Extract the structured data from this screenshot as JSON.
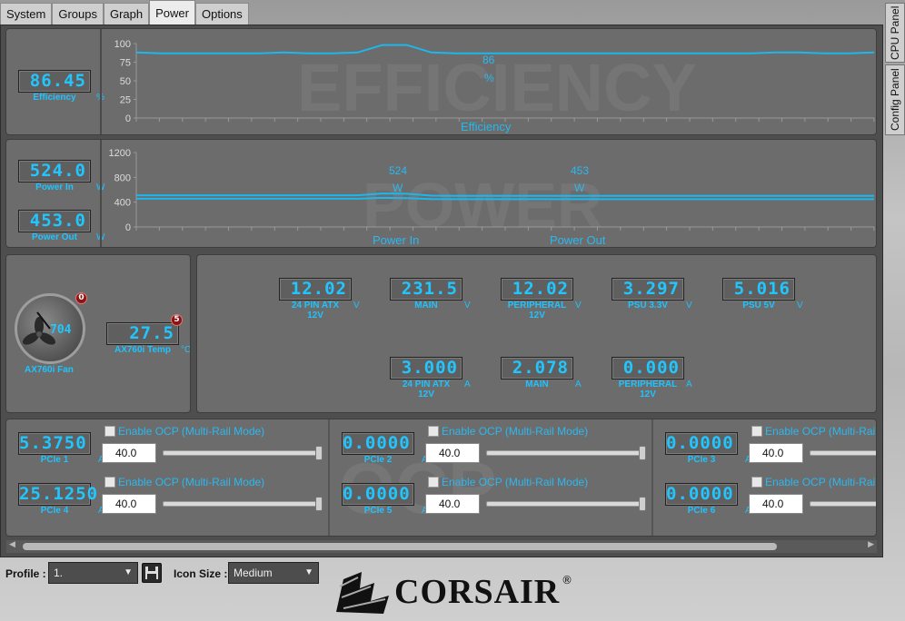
{
  "tabs": [
    "System",
    "Groups",
    "Graph",
    "Power",
    "Options"
  ],
  "active_tab": "Power",
  "side_tabs": [
    "CPU Panel",
    "Config Panel"
  ],
  "efficiency": {
    "watermark": "EFFICIENCY",
    "value": "86.45",
    "label": "Efficiency",
    "unit": "%",
    "legend": "Efficiency",
    "marker_value": "86",
    "marker_unit": "%",
    "chart_data": {
      "type": "line",
      "ylim": [
        0,
        100
      ],
      "yticks": [
        0,
        25,
        50,
        75,
        100
      ],
      "series": [
        {
          "name": "Efficiency",
          "values": [
            88,
            87,
            87,
            87,
            87,
            87,
            88,
            87,
            87,
            88,
            98,
            98,
            88,
            87,
            87,
            87,
            87,
            87,
            87,
            87,
            87,
            87,
            87,
            87,
            87,
            87,
            88,
            88,
            87,
            87,
            88
          ]
        }
      ]
    }
  },
  "power": {
    "watermark": "POWER",
    "power_in": {
      "value": "524.0",
      "label": "Power In",
      "unit": "W"
    },
    "power_out": {
      "value": "453.0",
      "label": "Power Out",
      "unit": "W"
    },
    "legend_in": "Power In",
    "legend_out": "Power Out",
    "marker_in": {
      "value": "524",
      "unit": "W"
    },
    "marker_out": {
      "value": "453",
      "unit": "W"
    },
    "chart_data": {
      "type": "line",
      "ylim": [
        0,
        1200
      ],
      "yticks": [
        0,
        400,
        800,
        1200
      ],
      "series": [
        {
          "name": "Power In",
          "values": [
            510,
            510,
            510,
            510,
            510,
            510,
            510,
            510,
            510,
            510,
            540,
            535,
            505,
            500,
            500,
            500,
            500,
            500,
            500,
            500,
            500,
            500,
            500,
            500,
            500,
            500,
            500,
            500,
            500,
            500,
            500
          ]
        },
        {
          "name": "Power Out",
          "values": [
            455,
            455,
            455,
            455,
            455,
            455,
            455,
            455,
            455,
            455,
            470,
            465,
            450,
            448,
            448,
            448,
            448,
            448,
            448,
            448,
            448,
            448,
            448,
            448,
            448,
            448,
            448,
            448,
            448,
            448,
            448
          ]
        }
      ]
    }
  },
  "fan": {
    "rpm": "704",
    "label": "AX760i Fan",
    "badge": "0"
  },
  "temp": {
    "value": "27.5",
    "label": "AX760i Temp",
    "unit": "°C",
    "badge": "5"
  },
  "voltages": [
    {
      "value": "12.02",
      "label": "24 PIN ATX",
      "label2": "12V",
      "unit": "V"
    },
    {
      "value": "231.5",
      "label": "MAIN",
      "label2": "",
      "unit": "V"
    },
    {
      "value": "12.02",
      "label": "PERIPHERAL",
      "label2": "12V",
      "unit": "V"
    },
    {
      "value": "3.297",
      "label": "PSU 3.3V",
      "label2": "",
      "unit": "V"
    },
    {
      "value": "5.016",
      "label": "PSU 5V",
      "label2": "",
      "unit": "V"
    }
  ],
  "currents": [
    {
      "value": "3.000",
      "label": "24 PIN ATX",
      "label2": "12V",
      "unit": "A"
    },
    {
      "value": "2.078",
      "label": "MAIN",
      "label2": "",
      "unit": "A"
    },
    {
      "value": "0.000",
      "label": "PERIPHERAL",
      "label2": "12V",
      "unit": "A"
    }
  ],
  "ocp": {
    "watermark": "OCP",
    "enable_label": "Enable OCP (Multi-Rail Mode)",
    "rails": [
      {
        "value": "5.3750",
        "label": "PCIe 1",
        "unit": "A",
        "limit": "40.0"
      },
      {
        "value": "25.1250",
        "label": "PCIe 4",
        "unit": "A",
        "limit": "40.0"
      },
      {
        "value": "0.0000",
        "label": "PCIe 2",
        "unit": "A",
        "limit": "40.0"
      },
      {
        "value": "0.0000",
        "label": "PCIe 5",
        "unit": "A",
        "limit": "40.0"
      },
      {
        "value": "0.0000",
        "label": "PCIe 3",
        "unit": "A",
        "limit": "40.0"
      },
      {
        "value": "0.0000",
        "label": "PCIe 6",
        "unit": "A",
        "limit": "40.0"
      }
    ]
  },
  "footer": {
    "profile_label": "Profile :",
    "profile_value": "1.",
    "icon_size_label": "Icon Size :",
    "icon_size_value": "Medium",
    "brand": "CORSAIR",
    "registered": "®"
  },
  "colors": {
    "accent": "#22c6ff",
    "panel": "#6c6c6c",
    "badge": "#8b1414"
  }
}
